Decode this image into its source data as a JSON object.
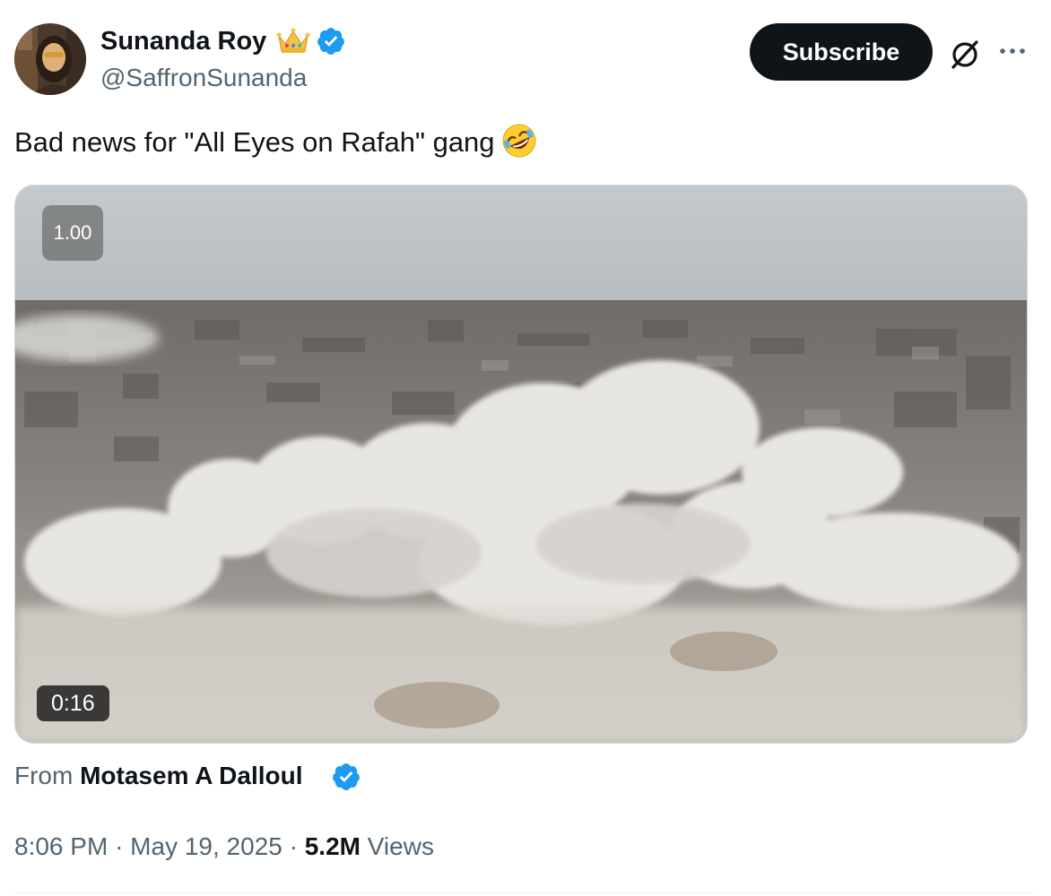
{
  "author": {
    "display_name": "Sunanda Roy",
    "handle": "@SaffronSunanda",
    "badges": [
      "crown-emoji",
      "verified-badge-icon"
    ]
  },
  "actions": {
    "subscribe_label": "Subscribe",
    "grok_icon": "grok-icon",
    "more_icon": "more-options-icon"
  },
  "tweet": {
    "text": "Bad news for \"All Eyes on Rafah\" gang",
    "emoji": "rolling-on-floor-laughing-emoji"
  },
  "media": {
    "playback_speed": "1.00",
    "duration": "0:16",
    "from_prefix": "From",
    "from_name": "Motasem A Dalloul"
  },
  "meta": {
    "time": "8:06 PM",
    "separator": "·",
    "date": "May 19, 2025",
    "views_count": "5.2M",
    "views_label": "Views"
  },
  "colors": {
    "text_primary": "#0f1419",
    "text_secondary": "#536471",
    "verified_blue": "#1d9bf0",
    "button_dark": "#0f1419"
  }
}
